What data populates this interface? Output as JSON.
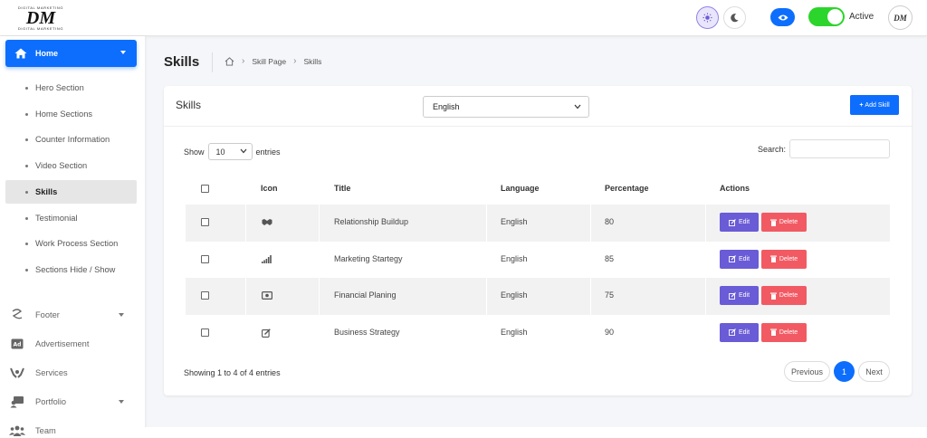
{
  "header": {
    "logo_tagline_top": "DIGITAL MARKETING",
    "logo_mark": "DM",
    "logo_tagline_bottom": "DIGITAL MARKETING",
    "status_label": "Active",
    "avatar_text": "DM"
  },
  "sidebar": {
    "home_label": "Home",
    "sub_items": [
      {
        "label": "Hero Section"
      },
      {
        "label": "Home Sections"
      },
      {
        "label": "Counter Information"
      },
      {
        "label": "Video Section"
      },
      {
        "label": "Skills"
      },
      {
        "label": "Testimonial"
      },
      {
        "label": "Work Process Section"
      },
      {
        "label": "Sections Hide / Show"
      }
    ],
    "main_items": [
      {
        "label": "Footer",
        "icon": "footer-icon"
      },
      {
        "label": "Advertisement",
        "icon": "ad-icon"
      },
      {
        "label": "Services",
        "icon": "services-icon"
      },
      {
        "label": "Portfolio",
        "icon": "portfolio-icon"
      },
      {
        "label": "Team",
        "icon": "team-icon"
      }
    ]
  },
  "page": {
    "title": "Skills",
    "breadcrumb": [
      "Skill Page",
      "Skills"
    ]
  },
  "card": {
    "title": "Skills",
    "language_selected": "English",
    "add_button": "Add Skill",
    "show_label": "Show",
    "entries_value": "10",
    "entries_label": "entries",
    "search_label": "Search:",
    "columns": [
      "Icon",
      "Title",
      "Language",
      "Percentage",
      "Actions"
    ],
    "rows": [
      {
        "icon": "handshake-icon",
        "title": "Relationship Buildup",
        "language": "English",
        "percentage": "80"
      },
      {
        "icon": "signal-bars-icon",
        "title": "Marketing Startegy",
        "language": "English",
        "percentage": "85"
      },
      {
        "icon": "money-bill-icon",
        "title": "Financial Planing",
        "language": "English",
        "percentage": "75"
      },
      {
        "icon": "edit-square-icon",
        "title": "Business Strategy",
        "language": "English",
        "percentage": "90"
      }
    ],
    "edit_label": "Edit",
    "delete_label": "Delete",
    "footer_info": "Showing 1 to 4 of 4 entries",
    "pagination": {
      "previous": "Previous",
      "current": "1",
      "next": "Next"
    }
  },
  "colors": {
    "primary": "#0d6efd",
    "edit": "#6a5bd6",
    "delete": "#f25a63",
    "toggle_on": "#2bd52b"
  }
}
